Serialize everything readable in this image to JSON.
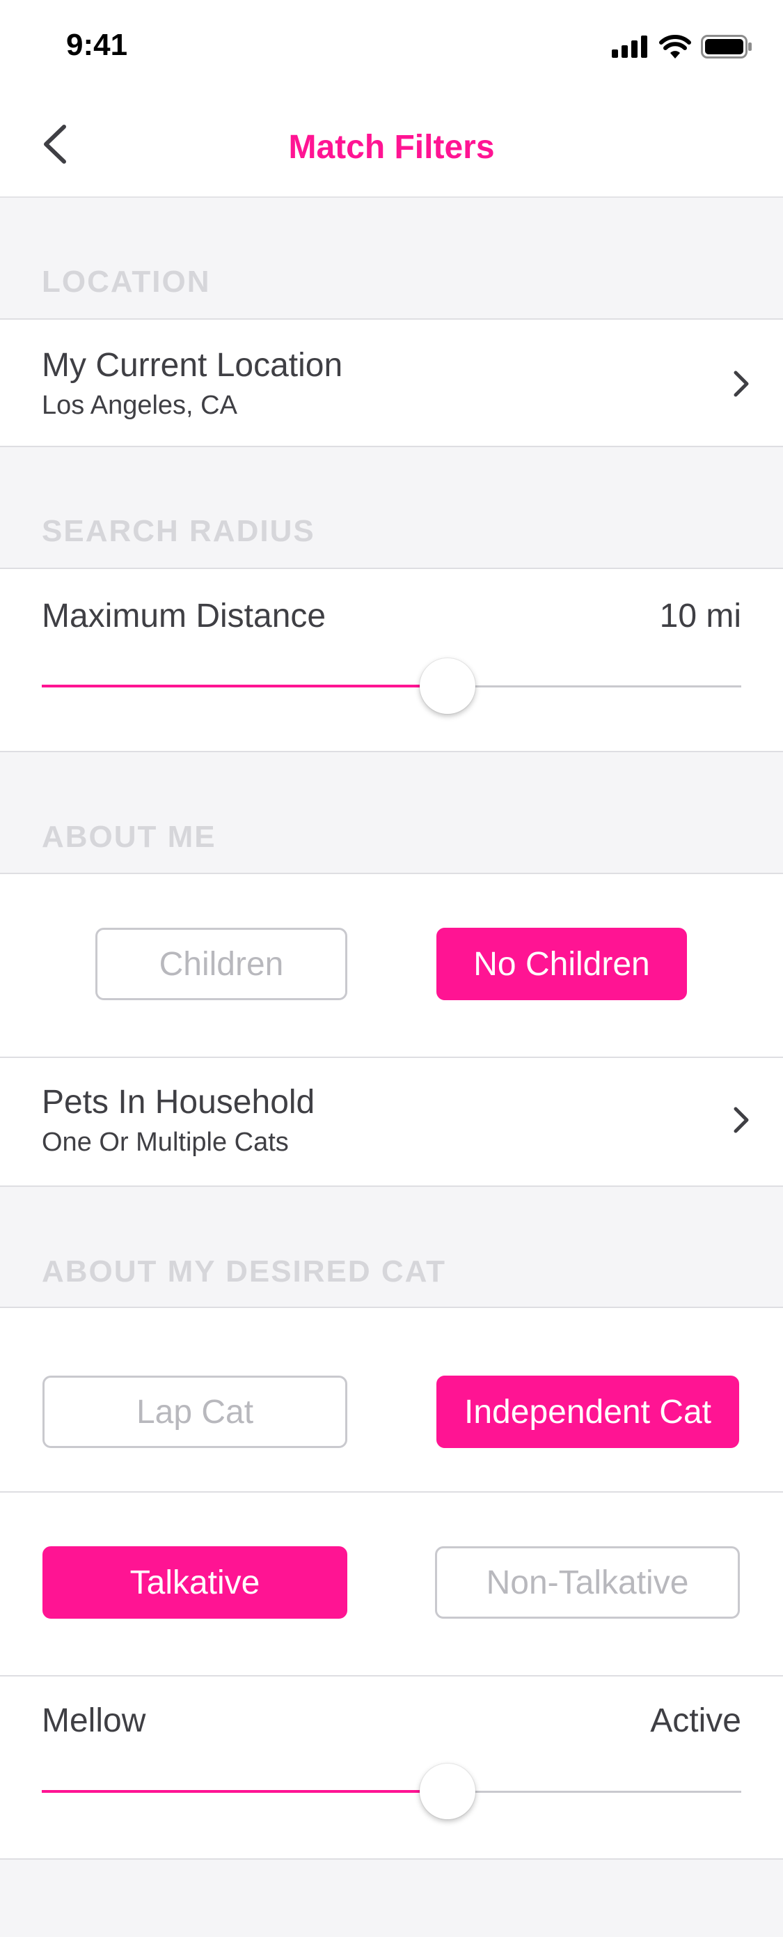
{
  "status_bar": {
    "time": "9:41"
  },
  "nav": {
    "title": "Match Filters"
  },
  "location": {
    "header": "LOCATION",
    "title": "My Current Location",
    "subtitle": "Los Angeles, CA"
  },
  "search_radius": {
    "header": "SEARCH RADIUS",
    "label": "Maximum Distance",
    "value": "10 mi",
    "slider_fraction": 0.58
  },
  "about_me": {
    "header": "ABOUT ME",
    "children_option": "Children",
    "no_children_option": "No Children",
    "selected": "No Children",
    "pets_title": "Pets In Household",
    "pets_value": "One Or Multiple Cats"
  },
  "desired_cat": {
    "header": "ABOUT MY DESIRED CAT",
    "lap_cat_option": "Lap Cat",
    "independent_option": "Independent Cat",
    "temperament_selected": "Independent Cat",
    "talkative_option": "Talkative",
    "non_talkative_option": "Non-Talkative",
    "talk_selected": "Talkative",
    "energy_low_label": "Mellow",
    "energy_high_label": "Active",
    "energy_slider_fraction": 0.58
  },
  "colors": {
    "accent": "#ff1493",
    "header_text": "#d6d6da",
    "background": "#f5f5f7"
  }
}
